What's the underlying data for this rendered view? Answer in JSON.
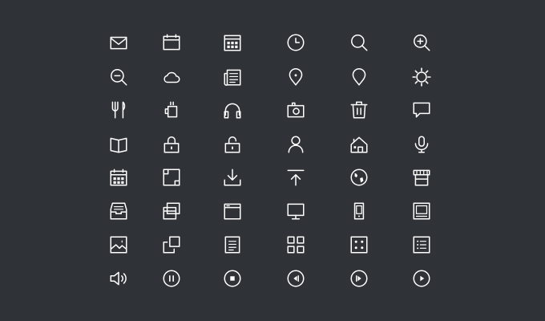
{
  "theme": {
    "background": "#2f3237",
    "stroke": "#ffffff"
  },
  "icons": [
    [
      "mail-icon",
      "browser-window-icon",
      "calendar-grid-icon",
      "clock-icon",
      "search-icon",
      "zoom-in-icon"
    ],
    [
      "zoom-out-icon",
      "cloud-icon",
      "newspaper-icon",
      "map-pin-icon",
      "location-pin-icon",
      "settings-icon"
    ],
    [
      "fork-knife-icon",
      "coffee-mug-icon",
      "headphones-icon",
      "camera-icon",
      "trash-icon",
      "chat-bubble-icon"
    ],
    [
      "book-icon",
      "lock-icon",
      "unlock-icon",
      "user-icon",
      "home-icon",
      "microphone-icon"
    ],
    [
      "calendar-icon",
      "crop-icon",
      "download-icon",
      "upload-icon",
      "globe-icon",
      "store-icon"
    ],
    [
      "inbox-icon",
      "windows-icon",
      "browser-icon",
      "monitor-icon",
      "mobile-icon",
      "tablet-icon"
    ],
    [
      "image-icon",
      "copy-icon",
      "document-icon",
      "grid-icon",
      "dice-icon",
      "list-icon"
    ],
    [
      "volume-icon",
      "pause-icon",
      "stop-icon",
      "rewind-icon",
      "fast-forward-icon",
      "play-icon"
    ]
  ]
}
